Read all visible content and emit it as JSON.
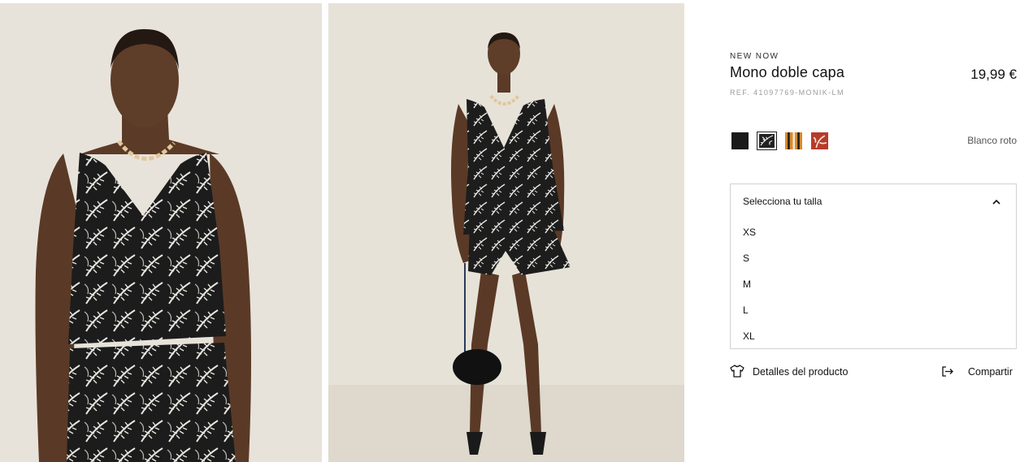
{
  "product": {
    "eyebrow": "NEW NOW",
    "title": "Mono doble capa",
    "price": "19,99 €",
    "reference": "REF. 41097769-MONIK-LM"
  },
  "colors": {
    "selected_name": "Blanco roto",
    "swatches": [
      {
        "name": "black-solid-swatch",
        "hex": "#1a1a1a"
      },
      {
        "name": "black-white-leaf-print-swatch",
        "hex": "#222222"
      },
      {
        "name": "orange-black-stripe-swatch",
        "hex": "#d98a2b"
      },
      {
        "name": "red-floral-swatch",
        "hex": "#b83a2a"
      }
    ]
  },
  "size_selector": {
    "label": "Selecciona tu talla",
    "options": [
      "XS",
      "S",
      "M",
      "L",
      "XL"
    ]
  },
  "actions": {
    "details_label": "Detalles del producto",
    "share_label": "Compartir"
  }
}
